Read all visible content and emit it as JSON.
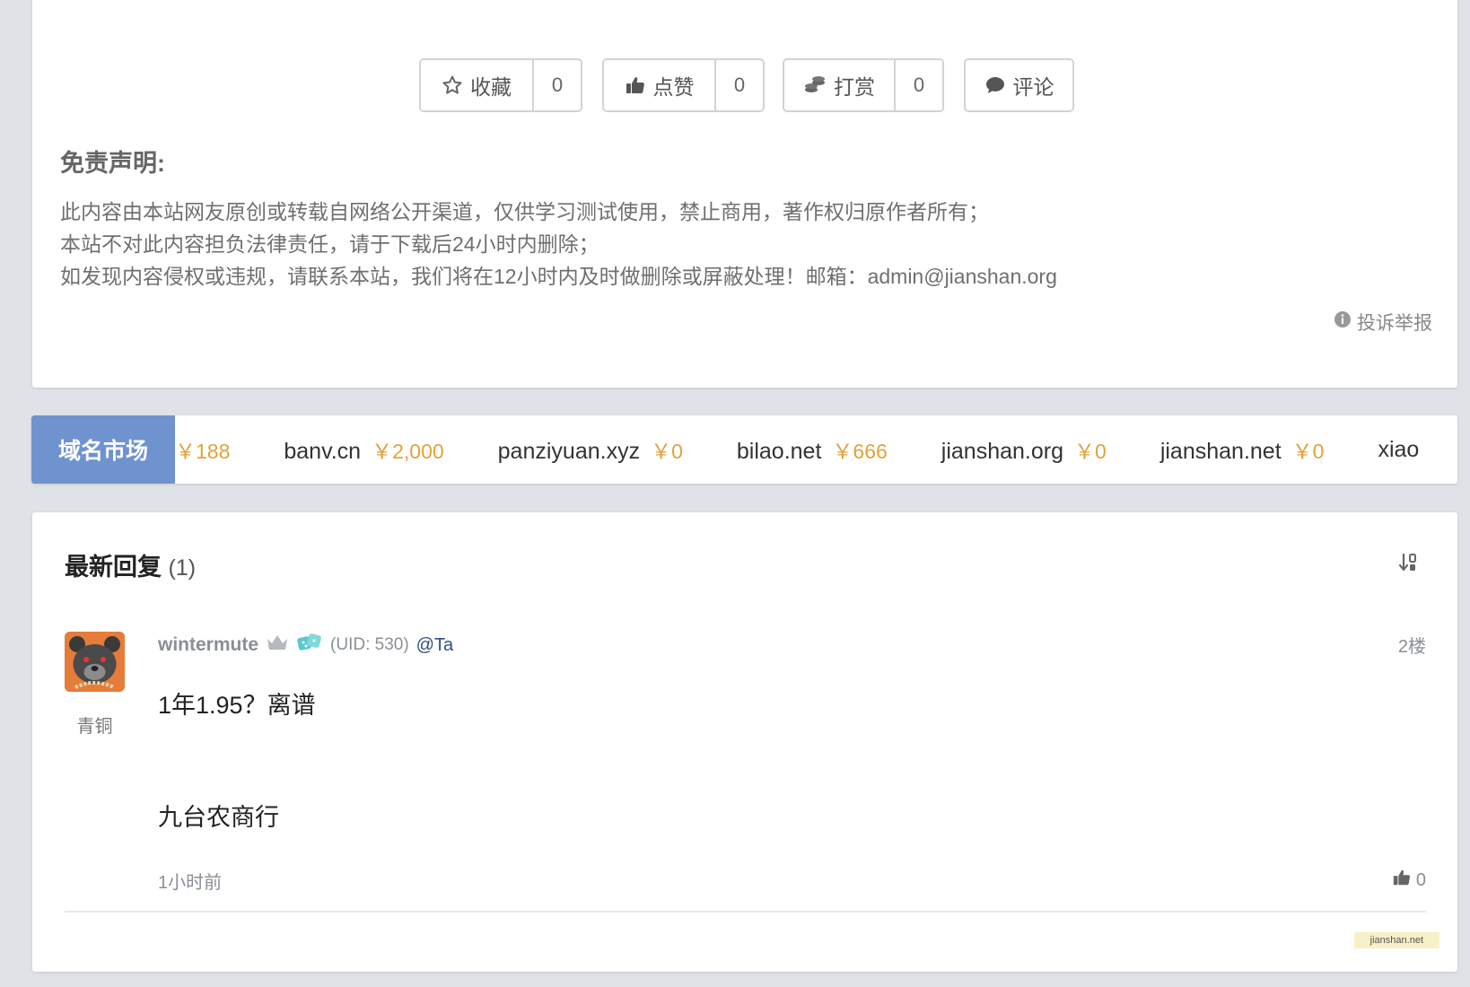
{
  "actions": {
    "favorite": {
      "label": "收藏",
      "count": "0"
    },
    "like": {
      "label": "点赞",
      "count": "0"
    },
    "tip": {
      "label": "打赏",
      "count": "0"
    },
    "comment": {
      "label": "评论"
    }
  },
  "disclaimer": {
    "title": "免责声明:",
    "lines": [
      "此内容由本站网友原创或转载自网络公开渠道，仅供学习测试使用，禁止商用，著作权归原作者所有；",
      "本站不对此内容担负法律责任，请于下载后24小时内删除；",
      "如发现内容侵权或违规，请联系本站，我们将在12小时内及时做删除或屏蔽处理！邮箱：admin@jianshan.org"
    ],
    "report_label": "投诉举报"
  },
  "domain_market": {
    "label": "域名市场",
    "items": [
      {
        "name": "",
        "price": "￥188"
      },
      {
        "name": "banv.cn",
        "price": "￥2,000"
      },
      {
        "name": "panziyuan.xyz",
        "price": "￥0"
      },
      {
        "name": "bilao.net",
        "price": "￥666"
      },
      {
        "name": "jianshan.org",
        "price": "￥0"
      },
      {
        "name": "jianshan.net",
        "price": "￥0"
      },
      {
        "name": "xiao",
        "price": ""
      }
    ]
  },
  "replies": {
    "title": "最新回复",
    "count": "(1)",
    "items": [
      {
        "username": "wintermute",
        "uid": "(UID: 530)",
        "at": "@Ta",
        "rank": "青铜",
        "floor": "2楼",
        "lines": [
          "1年1.95？离谱",
          "九台农商行"
        ],
        "time": "1小时前",
        "likes": "0"
      }
    ]
  },
  "watermark": "jianshan.net",
  "colors": {
    "accent_blue": "#6f93cf",
    "price_orange": "#e2a23b",
    "page_bg": "#dfe3e8"
  }
}
